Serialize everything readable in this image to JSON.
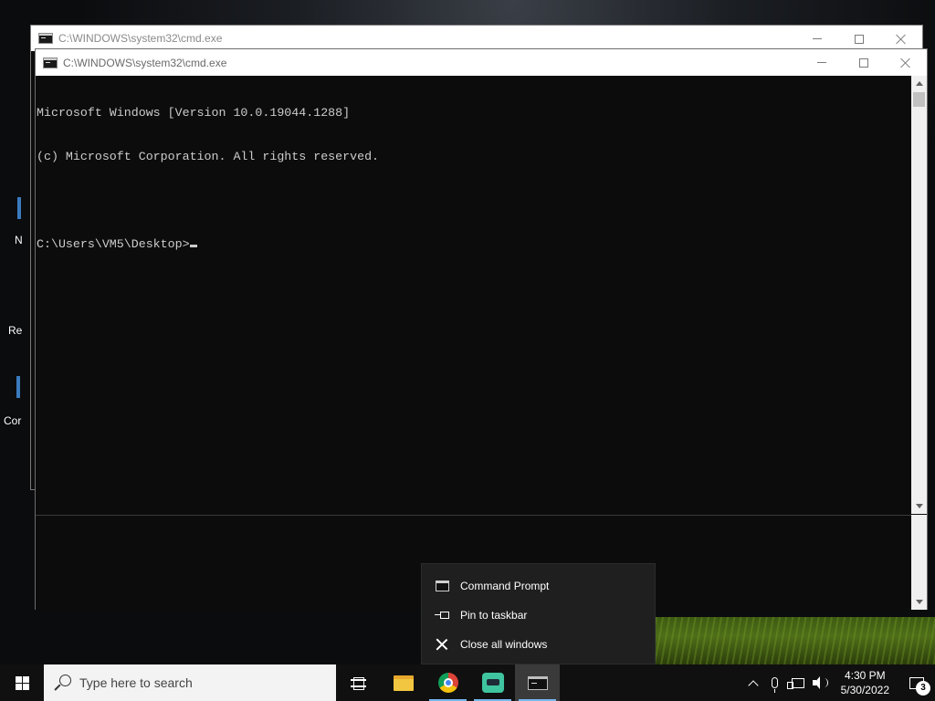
{
  "desktop": {
    "icon_labels": [
      "N",
      "Re",
      "Cor"
    ]
  },
  "back_window": {
    "title": "C:\\WINDOWS\\system32\\cmd.exe"
  },
  "front_window": {
    "title": "C:\\WINDOWS\\system32\\cmd.exe",
    "console_lines": [
      "Microsoft Windows [Version 10.0.19044.1288]",
      "(c) Microsoft Corporation. All rights reserved.",
      "",
      "C:\\Users\\VM5\\Desktop>"
    ]
  },
  "jump_list": {
    "items": [
      {
        "label": "Command Prompt",
        "icon": "cmd-icon"
      },
      {
        "label": "Pin to taskbar",
        "icon": "pin-icon"
      },
      {
        "label": "Close all windows",
        "icon": "close-icon"
      }
    ]
  },
  "taskbar": {
    "search_placeholder": "Type here to search",
    "apps": [
      "task-view-icon",
      "file-explorer-icon",
      "chrome-icon",
      "app-icon",
      "command-prompt-icon"
    ],
    "accent_color": "#76b9ed",
    "clock_time": "4:30 PM",
    "clock_date": "5/30/2022",
    "notification_count": "3"
  }
}
